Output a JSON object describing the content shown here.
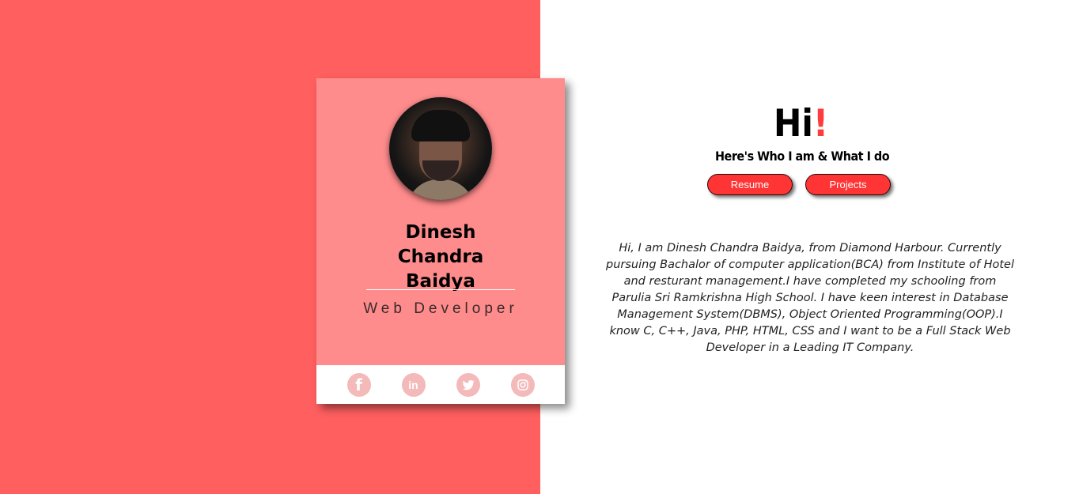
{
  "colors": {
    "left_background": "#ff5f5f",
    "card_background": "#ff8c8c",
    "accent": "#ff3434",
    "social_icon": "#f4b9b9"
  },
  "profile": {
    "name": "Dinesh Chandra Baidya",
    "role": "Web Developer",
    "avatar_alt": "profile photo"
  },
  "social": [
    {
      "icon": "facebook-icon",
      "glyph": "f"
    },
    {
      "icon": "linkedin-icon",
      "glyph": "in"
    },
    {
      "icon": "twitter-icon",
      "glyph": ""
    },
    {
      "icon": "instagram-icon",
      "glyph": ""
    }
  ],
  "intro": {
    "greeting": "Hi",
    "exclamation": "!",
    "subtitle": "Here's Who I am & What I do"
  },
  "buttons": {
    "resume": "Resume",
    "projects": "Projects"
  },
  "about": "Hi, I am Dinesh Chandra Baidya, from Diamond Harbour. Currently pursuing Bachalor of computer application(BCA) from Institute of Hotel and resturant management.I have completed my schooling from Parulia Sri Ramkrishna High School. I have keen interest in Database Management System(DBMS), Object Oriented Programming(OOP).I know C, C++, Java, PHP, HTML, CSS and I want to be a Full Stack Web Developer in a Leading IT Company."
}
